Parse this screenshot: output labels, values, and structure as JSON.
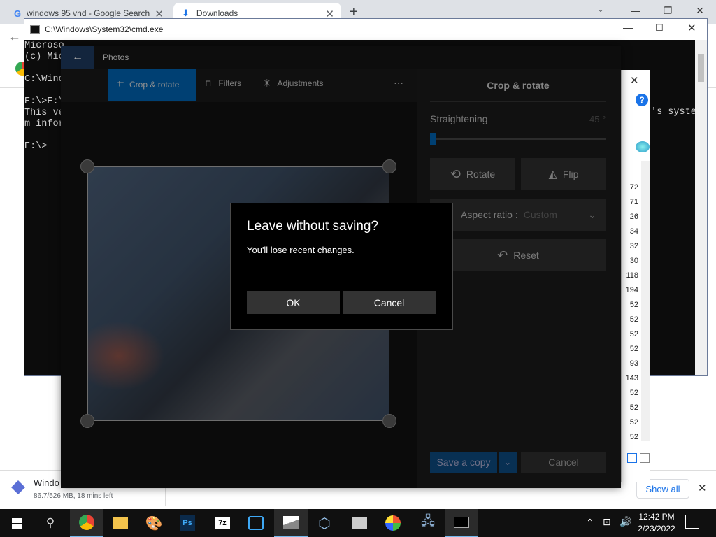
{
  "browser": {
    "tabs": [
      {
        "label": "windows 95 vhd - Google Search",
        "favicon": "G"
      },
      {
        "label": "Downloads"
      }
    ],
    "download": {
      "name": "Windo",
      "status": "86.7/526 MB, 18 mins left"
    },
    "show_all": "Show all"
  },
  "cmd": {
    "title": "C:\\Windows\\System32\\cmd.exe",
    "lines": [
      "Microso",
      "(c) Mic",
      "",
      "C:\\Wind",
      "",
      "E:\\>E:\\",
      "This ve",
      "m infor",
      "",
      "E:\\>"
    ],
    "right_text": "'s syste"
  },
  "explorer": {
    "numbers": [
      "72",
      "71",
      "26",
      "34",
      "32",
      "30",
      "118",
      "194",
      "52",
      "52",
      "52",
      "52",
      "93",
      "143",
      "52",
      "52",
      "52",
      "52"
    ]
  },
  "photos": {
    "app_title": "Photos",
    "tools": {
      "crop": "Crop & rotate",
      "filters": "Filters",
      "adjustments": "Adjustments",
      "more": "···"
    },
    "panel": {
      "heading": "Crop & rotate",
      "straightening_label": "Straightening",
      "straightening_value": "45 °",
      "straightening_level": 0,
      "rotate": "Rotate",
      "flip": "Flip",
      "aspect_label": "Aspect ratio :",
      "aspect_value": "Custom",
      "reset": "Reset",
      "save_copy": "Save a copy",
      "cancel": "Cancel"
    }
  },
  "dialog": {
    "title": "Leave without saving?",
    "message": "You'll lose recent changes.",
    "ok": "OK",
    "cancel": "Cancel"
  },
  "taskbar": {
    "time": "12:42 PM",
    "date": "2/23/2022",
    "apps": [
      "chrome",
      "file-explorer",
      "paint",
      "photoshop",
      "7zip",
      "tool",
      "photos",
      "virtualbox",
      "disk",
      "pinwheel",
      "network",
      "terminal"
    ]
  }
}
